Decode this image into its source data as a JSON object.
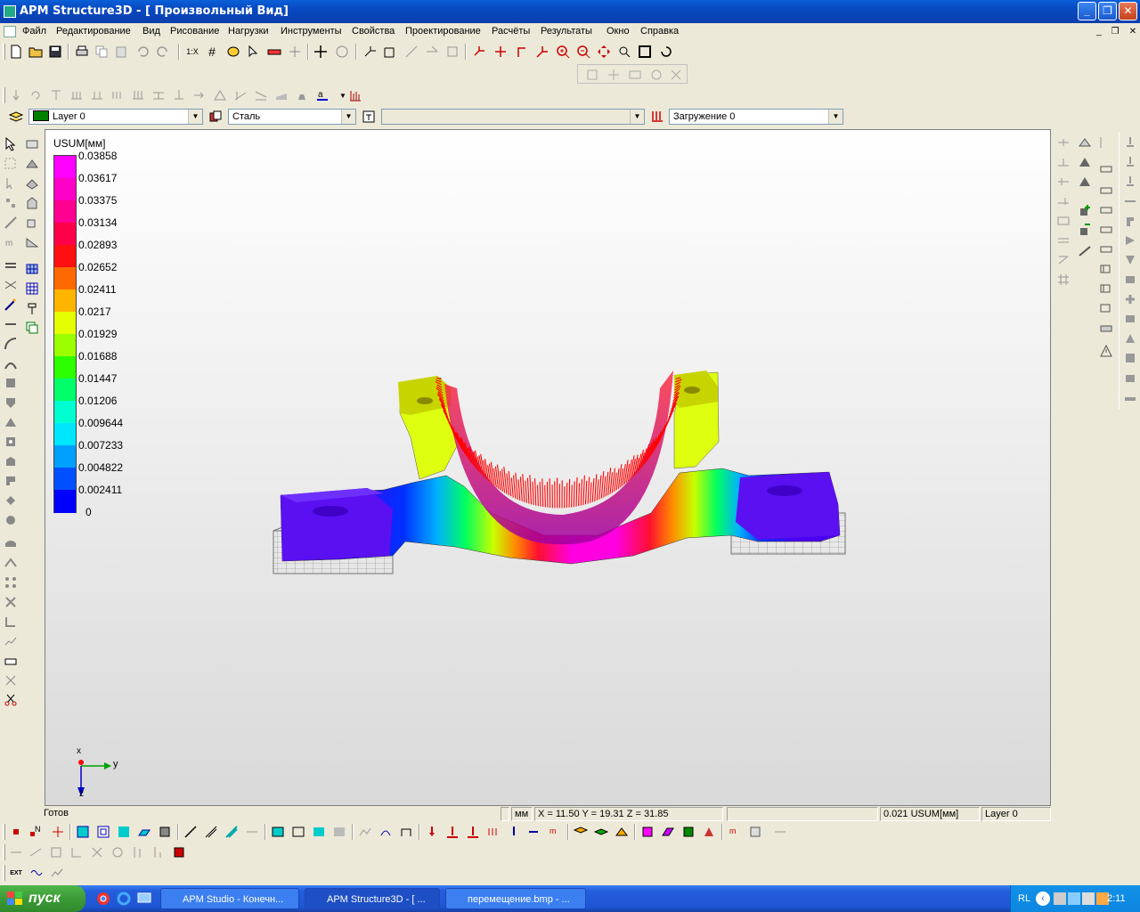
{
  "window": {
    "title": "APM Structure3D - [ Произвольный Вид]",
    "minimize": "_",
    "maximize": "❐",
    "close": "✕"
  },
  "menu": [
    "Файл",
    "Редактирование",
    "Вид",
    "Рисование",
    "Нагрузки",
    "Инструменты",
    "Свойства",
    "Проектирование",
    "Расчёты",
    "Результаты",
    "Окно",
    "Справка"
  ],
  "mdi_controls": [
    "_",
    "❐",
    "✕"
  ],
  "toolbar": {
    "scale_label": "1:X"
  },
  "combos": {
    "layer": "Layer 0",
    "material": "Сталь",
    "section": "",
    "loadcase": "Загружение 0"
  },
  "legend": {
    "title": "USUM[мм]",
    "labels": [
      "0.03858",
      "0.03617",
      "0.03375",
      "0.03134",
      "0.02893",
      "0.02652",
      "0.02411",
      "0.0217",
      "0.01929",
      "0.01688",
      "0.01447",
      "0.01206",
      "0.009644",
      "0.007233",
      "0.004822",
      "0.002411",
      "0"
    ],
    "colors": [
      "#ff00ff",
      "#ff00c8",
      "#ff0090",
      "#ff0048",
      "#ff1010",
      "#ff6a00",
      "#ffb400",
      "#e6ff00",
      "#9cff00",
      "#2cff00",
      "#00ff6a",
      "#00ffd0",
      "#00e6ff",
      "#00a0ff",
      "#0050ff",
      "#0000ff",
      "#5a00ff"
    ]
  },
  "axes": {
    "x": "x",
    "y": "y",
    "z": "z"
  },
  "status": {
    "ready": "Готов",
    "units": "мм",
    "coords": "X = 11.50 Y = 19.31 Z = 31.85",
    "value": "0.021 USUM[мм]",
    "layer": "Layer 0"
  },
  "bottom_toolbar": {
    "ext_label": "EXT"
  },
  "taskbar": {
    "start": "пуск",
    "tasks": [
      "APM Studio - Конечн...",
      "APM Structure3D - [ ...",
      "перемещение.bmp - ..."
    ],
    "lang": "RL",
    "clock": "2:11"
  }
}
